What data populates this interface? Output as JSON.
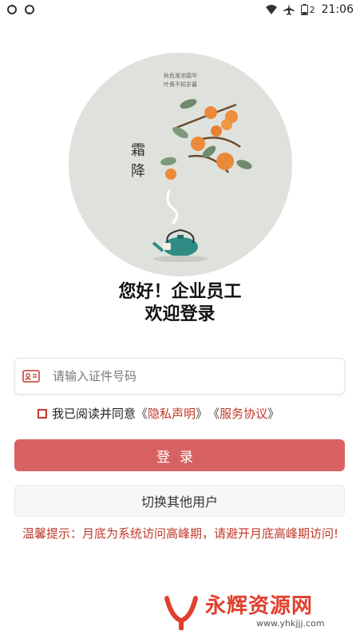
{
  "status_bar": {
    "time": "21:06",
    "battery": "2",
    "icons": [
      "sync-icon",
      "sync-icon",
      "wifi-icon",
      "airplane-icon",
      "battery-icon"
    ]
  },
  "hero": {
    "poem": "秋色渐浓霜华\n叶黄不知岁暮",
    "solar_term": "霜降"
  },
  "greeting": {
    "line1": "您好！企业员工",
    "line2": "欢迎登录"
  },
  "id_field": {
    "placeholder": "请输入证件号码",
    "value": "",
    "icon": "id-card-icon"
  },
  "agreement": {
    "prefix": "我已阅读并同意",
    "bracket_open_1": "《",
    "privacy": "隐私声明",
    "bracket_close_1": "》",
    "bracket_open_2": "《",
    "service": "服务协议",
    "bracket_close_2": "》",
    "checked": false
  },
  "buttons": {
    "login": "登录",
    "switch_user": "切换其他用户"
  },
  "notice": "温馨提示：月底为系统访问高峰期，请避开月底高峰期访问!",
  "watermark": {
    "title": "永辉资源网",
    "url": "www.yhkjjj.com"
  },
  "colors": {
    "accent": "#d86262",
    "notice": "#c0392b",
    "hero_bg": "#dfe2dc"
  }
}
